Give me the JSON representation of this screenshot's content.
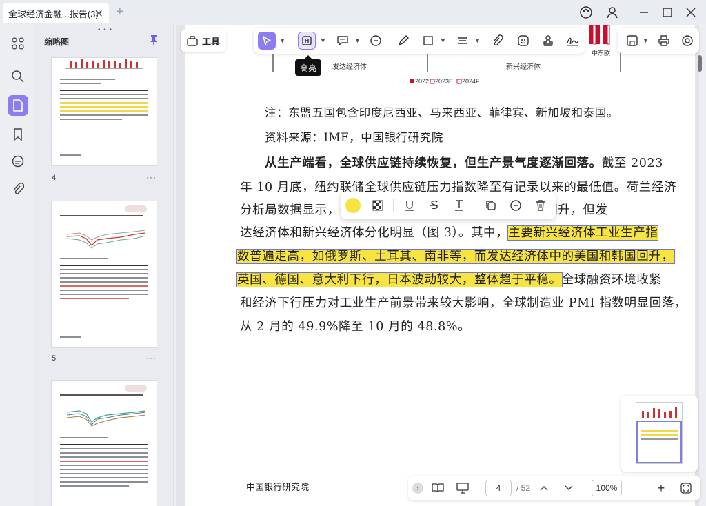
{
  "window": {
    "tab_title": "全球经济金融...报告(3)*",
    "close_glyph": "✕",
    "new_tab_glyph": "+"
  },
  "sidebar": {
    "panel_title": "缩略图",
    "thumbnails": [
      {
        "page": "4",
        "more": "···"
      },
      {
        "page": "5",
        "more": "···"
      },
      {
        "page": "",
        "more": ""
      }
    ]
  },
  "toolbar": {
    "tools_label": "工具",
    "tooltip": "高亮",
    "items": [
      "select-tool",
      "highlight-tool",
      "comment-tool",
      "note-tool",
      "pencil-tool",
      "shape-tool",
      "measure-tool",
      "attach-tool",
      "sticker-tool",
      "stamp-tool",
      "signature-tool"
    ]
  },
  "document": {
    "chart_region_labels": {
      "group1": "发达经济体",
      "group2": "新兴经济体",
      "last_col": "中东欧",
      "legend": [
        "2022",
        "2023E",
        "2024F"
      ]
    },
    "note_line": "注：东盟五国包含印度尼西亚、马来西亚、菲律宾、新加坡和泰国。",
    "source_line": "资料来源：IMF，中国银行研究院",
    "para_bold": "从生产端看，全球供应链持续恢复，但生产景气度逐渐回落。",
    "para_l1_tail": "截至 2023",
    "para_l2": "年 10 月底，纽约联储全球供应链压力指数降至有记录以来的最低值。荷兰经济",
    "para_l3_head": "分析局数据显示，全",
    "para_l3_tail": "月逐月回升，但发",
    "para_l4_head": "达经济体和新兴经济体分化明显（图 3）。其中，",
    "para_l4_hl": "主要新兴经济体工业生产指",
    "para_l5_hl": "数普遍走高，如俄罗斯、土耳其、南非等，而发达经济体中的美国和韩国回升，",
    "para_l6_hl": "英国、德国、意大利下行，日本波动较大，整体趋于平稳。",
    "para_l6_tail": "全球融资环境收紧",
    "para_l7": "和经济下行压力对工业生产前景带来较大影响，全球制造业 PMI 指数明显回落，",
    "para_l8": "从 2 月的 49.9%降至 10 月的 48.8%。",
    "footer": "中国银行研究院"
  },
  "navigation": {
    "current_page": "4",
    "total_pages": "/ 52",
    "zoom": "100%",
    "zoom_out": "—",
    "zoom_in": "+"
  },
  "colors": {
    "accent": "#8c7cf0",
    "highlight": "#f7e342",
    "highlight_outline": "#6b77d6"
  }
}
